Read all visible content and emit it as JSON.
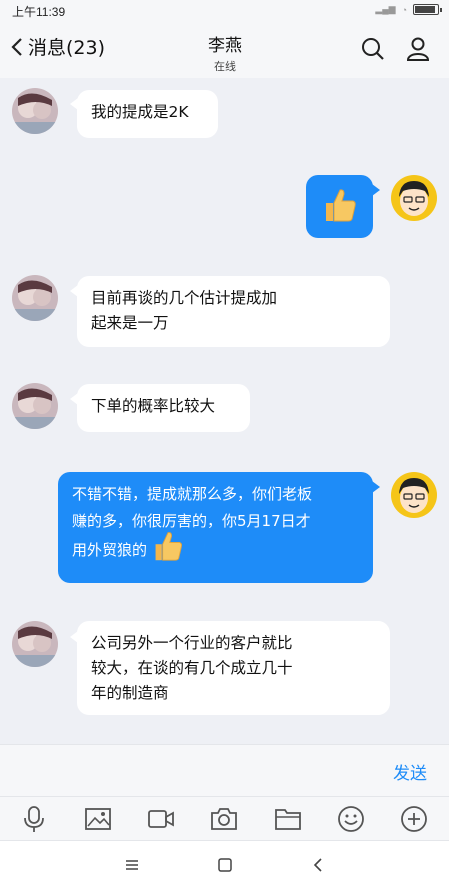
{
  "status_bar": {
    "time": "上午11:39",
    "battery_level": 0.9
  },
  "header": {
    "back_label": "消息(23)",
    "contact_name": "李燕",
    "contact_status": "在线"
  },
  "messages": [
    {
      "side": "left",
      "text": "我的提成是2K"
    },
    {
      "side": "right",
      "type": "emoji",
      "emoji": "thumbs-up"
    },
    {
      "side": "left",
      "lines": [
        "目前再谈的几个估计提成加",
        "起来是一万"
      ]
    },
    {
      "side": "left",
      "text": "下单的概率比较大"
    },
    {
      "side": "right",
      "lines": [
        "不错不错，提成就那么多，你们老板",
        "赚的多，你很厉害的，你5月17日才",
        "用外贸狼的"
      ],
      "emoji": "thumbs-up"
    },
    {
      "side": "left",
      "lines": [
        "公司另外一个行业的客户就比",
        "较大，在谈的有几个成立几十",
        "年的制造商"
      ]
    }
  ],
  "input": {
    "send_label": "发送"
  },
  "toolbar": [
    "microphone-icon",
    "image-icon",
    "video-icon",
    "camera-icon",
    "folder-icon",
    "emoji-icon",
    "plus-icon"
  ],
  "navbar": [
    "menu-icon",
    "home-icon",
    "back-icon"
  ],
  "colors": {
    "accent": "#1e8cf8",
    "background": "#eef0f5"
  }
}
